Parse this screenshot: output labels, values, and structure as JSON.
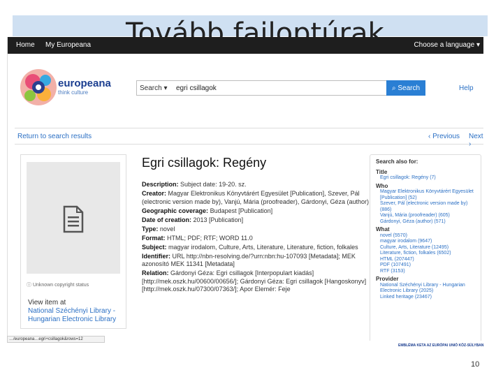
{
  "slide": {
    "title": "Tovább failoptúrak",
    "page_number": "10",
    "funding_note": "EMBLÉMA KETA AZ EURÓPAI UNIÓ KÖZ-SÚLYBAN"
  },
  "browser": {
    "status_url": "…/europeana…egri+csillagok&rows=12"
  },
  "topnav": {
    "home": "Home",
    "my_europeana": "My Europeana",
    "language": "Choose a language ▾"
  },
  "brand": {
    "name": "europeana",
    "tagline": "think culture"
  },
  "search": {
    "type_label": "Search ▾",
    "query": "egri csillagok",
    "button_label": "Search",
    "help_label": "Help"
  },
  "results_nav": {
    "back": "Return to search results",
    "previous": "‹ Previous",
    "next": "Next ›"
  },
  "thumb": {
    "rights": "Unknown copyright status",
    "view_prefix": "View item at",
    "view_link": "National Széchényi Library - Hungarian Electronic Library"
  },
  "record": {
    "title": "Egri csillagok: Regény",
    "fields": [
      {
        "label": "Description:",
        "value": "Subject date: 19-20. sz."
      },
      {
        "label": "Creator:",
        "value": "Magyar Elektronikus Könyvtárért Egyesület [Publication], Szever, Pál (electronic version made by), Vanjú, Mária (proofreader), Gárdonyi, Géza (author)"
      },
      {
        "label": "Geographic coverage:",
        "value": "Budapest [Publication]"
      },
      {
        "label": "Date of creation:",
        "value": "2013 [Publication]"
      },
      {
        "label": "Type:",
        "value": "novel"
      },
      {
        "label": "Format:",
        "value": "HTML; PDF; RTF; WORD 11.0"
      },
      {
        "label": "Subject:",
        "value": "magyar irodalom, Culture, Arts, Literature, Literature, fiction, folkales"
      },
      {
        "label": "Identifier:",
        "value": "URL http://nbn-resolving.de/?urn:nbn:hu-107093 [Metadata]; MEK azonosító MEK 11341 [Metadata]"
      },
      {
        "label": "Relation:",
        "value": "Gárdonyi Géza: Egri csillagok [Interpopulart kiadás] [http://mek.oszk.hu/00600/00656/]; Gárdonyi Géza: Egri csillagok [Hangoskonyv] [http://mek.oszk.hu/07300/07363/]; Apor Elemér: Feje"
      }
    ]
  },
  "sidebar": {
    "heading": "Search also for:",
    "groups": [
      {
        "label": "Title",
        "links": [
          "Egri csillagok: Regény (7)"
        ]
      },
      {
        "label": "Who",
        "links": [
          "Magyar Elektronikus Könyvtárért Egyesület [Publication] (52)",
          "Szever, Pál (electronic version made by) (886)",
          "Vanjú, Mária (proofreader) (605)",
          "Gárdonyi, Géza (author) (571)"
        ]
      },
      {
        "label": "What",
        "links": [
          "novel (5570)",
          "magyar irodalom (9647)",
          "Culture, Arts, Literature (12495)",
          "Literature, fiction, folkales (6502)",
          "HTML (207447)",
          "PDF (107491)",
          "RTF (3153)"
        ]
      },
      {
        "label": "Provider",
        "links": [
          "National Széchényi Library - Hungarian Electronic Library (2025)",
          "Linked heritage (23467)"
        ]
      }
    ]
  },
  "colors": {
    "nav_bg": "#1e1e1e",
    "accent_blue": "#2a7fd4",
    "link_blue": "#2a6fc4",
    "slide_header": "#cfe0f2"
  }
}
